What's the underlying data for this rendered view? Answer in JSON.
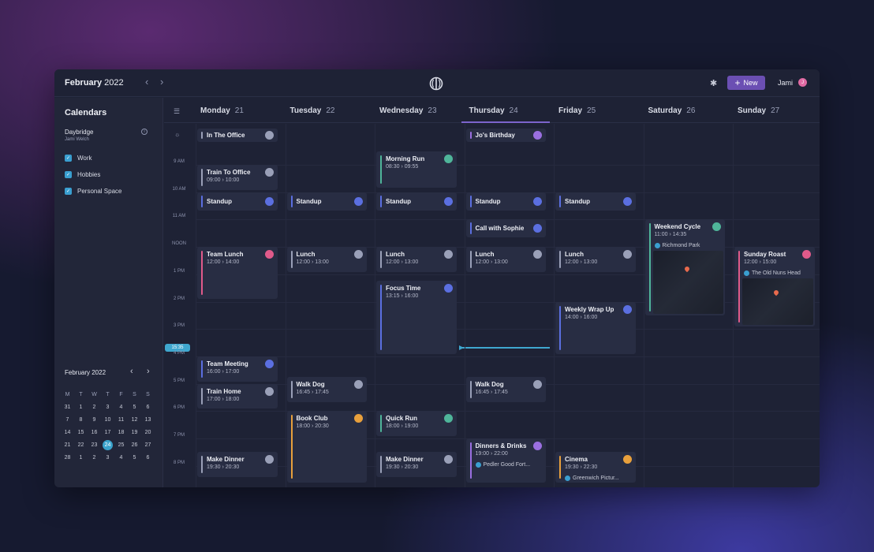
{
  "topbar": {
    "month_bold": "February",
    "year": "2022",
    "prev": "‹",
    "next": "›",
    "new_label": "New",
    "user_name": "Jami",
    "avatar_initial": "J",
    "settings_icon": "gear-icon"
  },
  "sidebar": {
    "calendars_title": "Calendars",
    "account_name": "Daybridge",
    "account_user": "Jami Welch",
    "calendars": [
      {
        "label": "Work",
        "checked": true
      },
      {
        "label": "Hobbies",
        "checked": true
      },
      {
        "label": "Personal Space",
        "checked": true
      }
    ],
    "mini_calendar": {
      "title": "February 2022",
      "dow": [
        "M",
        "T",
        "W",
        "T",
        "F",
        "S",
        "S"
      ],
      "weeks": [
        [
          "31",
          "1",
          "2",
          "3",
          "4",
          "5",
          "6"
        ],
        [
          "7",
          "8",
          "9",
          "10",
          "11",
          "12",
          "13"
        ],
        [
          "14",
          "15",
          "16",
          "17",
          "18",
          "19",
          "20"
        ],
        [
          "21",
          "22",
          "23",
          "24",
          "25",
          "26",
          "27"
        ],
        [
          "28",
          "1",
          "2",
          "3",
          "4",
          "5",
          "6"
        ]
      ],
      "today": "24"
    }
  },
  "days": [
    {
      "name": "Monday",
      "num": "21"
    },
    {
      "name": "Tuesday",
      "num": "22"
    },
    {
      "name": "Wednesday",
      "num": "23"
    },
    {
      "name": "Thursday",
      "num": "24"
    },
    {
      "name": "Friday",
      "num": "25"
    },
    {
      "name": "Saturday",
      "num": "26"
    },
    {
      "name": "Sunday",
      "num": "27"
    }
  ],
  "hours": [
    "9 AM",
    "10 AM",
    "11 AM",
    "NOON",
    "1 PM",
    "2 PM",
    "3 PM",
    "4 PM",
    "5 PM",
    "6 PM",
    "7 PM",
    "8 PM"
  ],
  "now_label": "15:35",
  "colors": {
    "work": "#5b6fe0",
    "grey": "#9aa0b8",
    "pink": "#e05a8a",
    "teal": "#4fb59a",
    "orange": "#e8a03c",
    "purple": "#9a6fe0",
    "accent": "#6b4fb3",
    "now": "#3fa7cf"
  },
  "events": [
    {
      "day": 0,
      "title": "In The Office",
      "time": "",
      "start": "allday",
      "color": "#9aa0b8",
      "icon": "building-icon"
    },
    {
      "day": 3,
      "title": "Jo's Birthday",
      "time": "",
      "start": "allday",
      "color": "#9a6fe0",
      "icon": "gift-icon"
    },
    {
      "day": 0,
      "title": "Train To Office",
      "time": "09:00 › 10:00",
      "start": 9.0,
      "end": 10.0,
      "color": "#9aa0b8",
      "icon": "train-icon"
    },
    {
      "day": 2,
      "title": "Morning Run",
      "time": "08:30 › 09:55",
      "start": 8.5,
      "end": 9.92,
      "color": "#4fb59a",
      "icon": "run-icon"
    },
    {
      "day": 0,
      "title": "Standup",
      "time": "",
      "start": 10.0,
      "end": 10.75,
      "color": "#5b6fe0",
      "icon": "sync-icon"
    },
    {
      "day": 1,
      "title": "Standup",
      "time": "",
      "start": 10.0,
      "end": 10.75,
      "color": "#5b6fe0",
      "icon": "sync-icon"
    },
    {
      "day": 2,
      "title": "Standup",
      "time": "",
      "start": 10.0,
      "end": 10.75,
      "color": "#5b6fe0",
      "icon": "sync-icon"
    },
    {
      "day": 3,
      "title": "Standup",
      "time": "",
      "start": 10.0,
      "end": 10.75,
      "color": "#5b6fe0",
      "icon": "sync-icon"
    },
    {
      "day": 4,
      "title": "Standup",
      "time": "",
      "start": 10.0,
      "end": 10.75,
      "color": "#5b6fe0",
      "icon": "sync-icon"
    },
    {
      "day": 3,
      "title": "Call with Sophie",
      "time": "",
      "start": 11.0,
      "end": 11.75,
      "color": "#5b6fe0",
      "icon": "phone-icon"
    },
    {
      "day": 5,
      "title": "Weekend Cycle",
      "time": "11:00 › 14:35",
      "start": 11.0,
      "end": 14.6,
      "color": "#4fb59a",
      "icon": "bike-icon",
      "location": "Richmond Park",
      "map": true
    },
    {
      "day": 0,
      "title": "Team Lunch",
      "time": "12:00 › 14:00",
      "start": 12.0,
      "end": 14.0,
      "color": "#e05a8a",
      "icon": "cutlery-icon"
    },
    {
      "day": 1,
      "title": "Lunch",
      "time": "12:00 › 13:00",
      "start": 12.0,
      "end": 13.0,
      "color": "#9aa0b8",
      "icon": "cutlery-icon"
    },
    {
      "day": 2,
      "title": "Lunch",
      "time": "12:00 › 13:00",
      "start": 12.0,
      "end": 13.0,
      "color": "#9aa0b8",
      "icon": "cutlery-icon"
    },
    {
      "day": 3,
      "title": "Lunch",
      "time": "12:00 › 13:00",
      "start": 12.0,
      "end": 13.0,
      "color": "#9aa0b8",
      "icon": "cutlery-icon"
    },
    {
      "day": 4,
      "title": "Lunch",
      "time": "12:00 › 13:00",
      "start": 12.0,
      "end": 13.0,
      "color": "#9aa0b8",
      "icon": "cutlery-icon"
    },
    {
      "day": 6,
      "title": "Sunday Roast",
      "time": "12:00 › 15:00",
      "start": 12.0,
      "end": 15.0,
      "color": "#e05a8a",
      "icon": "cutlery-icon",
      "location": "The Old Nuns Head",
      "map": true
    },
    {
      "day": 2,
      "title": "Focus Time",
      "time": "13:15 › 16:00",
      "start": 13.25,
      "end": 16.0,
      "color": "#5b6fe0",
      "icon": "focus-icon"
    },
    {
      "day": 4,
      "title": "Weekly Wrap Up",
      "time": "14:00 › 16:00",
      "start": 14.0,
      "end": 16.0,
      "color": "#5b6fe0",
      "icon": "video-icon"
    },
    {
      "day": 0,
      "title": "Team Meeting",
      "time": "16:00 › 17:00",
      "start": 16.0,
      "end": 17.0,
      "color": "#5b6fe0",
      "icon": "sync-icon"
    },
    {
      "day": 0,
      "title": "Train Home",
      "time": "17:00 › 18:00",
      "start": 17.0,
      "end": 18.0,
      "color": "#9aa0b8",
      "icon": "train-icon"
    },
    {
      "day": 1,
      "title": "Walk Dog",
      "time": "16:45 › 17:45",
      "start": 16.75,
      "end": 17.75,
      "color": "#9aa0b8",
      "icon": "paw-icon"
    },
    {
      "day": 3,
      "title": "Walk Dog",
      "time": "16:45 › 17:45",
      "start": 16.75,
      "end": 17.75,
      "color": "#9aa0b8",
      "icon": "paw-icon"
    },
    {
      "day": 1,
      "title": "Book Club",
      "time": "18:00 › 20:30",
      "start": 18.0,
      "end": 20.7,
      "color": "#e8a03c",
      "icon": "book-icon"
    },
    {
      "day": 2,
      "title": "Quick Run",
      "time": "18:00 › 19:00",
      "start": 18.0,
      "end": 19.0,
      "color": "#4fb59a",
      "icon": "run-icon"
    },
    {
      "day": 3,
      "title": "Dinners & Drinks",
      "time": "19:00 › 22:00",
      "start": 19.0,
      "end": 20.7,
      "color": "#9a6fe0",
      "icon": "drink-icon",
      "location": "Pedler Good Fort..."
    },
    {
      "day": 0,
      "title": "Make Dinner",
      "time": "19:30 › 20:30",
      "start": 19.5,
      "end": 20.5,
      "color": "#9aa0b8",
      "icon": "chef-icon"
    },
    {
      "day": 2,
      "title": "Make Dinner",
      "time": "19:30 › 20:30",
      "start": 19.5,
      "end": 20.5,
      "color": "#9aa0b8",
      "icon": "chef-icon"
    },
    {
      "day": 4,
      "title": "Cinema",
      "time": "19:30 › 22:30",
      "start": 19.5,
      "end": 20.7,
      "color": "#e8a03c",
      "icon": "film-icon",
      "location": "Greenwich Pictur..."
    }
  ]
}
